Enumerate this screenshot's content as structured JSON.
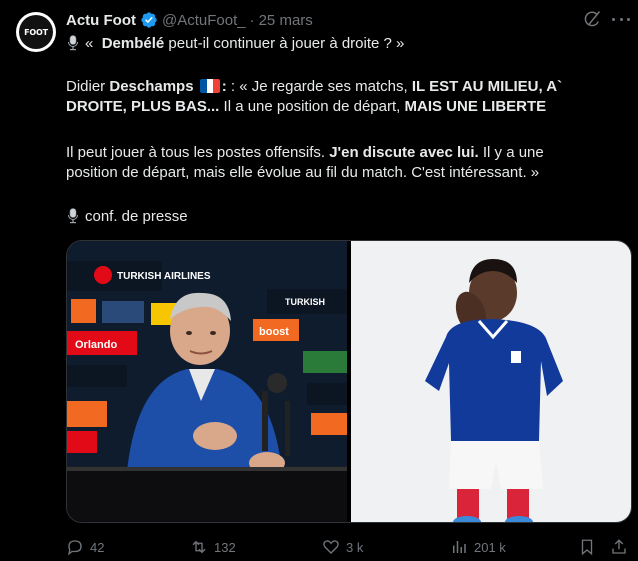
{
  "author": {
    "display_name": "Actu Foot",
    "handle": "@ActuFoot_",
    "separator": "·",
    "date": "25 mars",
    "avatar_text": "FOOT",
    "verified_color": "#1d9bf0"
  },
  "tweet": {
    "line1_prefix": "«",
    "line1_bold": "Dembélé",
    "line1_rest": " peut-il continuer à jouer à droite ? »",
    "line2_a": "Didier ",
    "line2_bold": "Deschamps",
    "line2_b": " : « Je regarde ses matchs, ",
    "line2_caps": "IL EST AU MILIEU, A`",
    "line3_caps": "DROITE, PLUS BAS...",
    "line3_mid": " Il a une position de départ, ",
    "line3_caps2": "MAIS UNE LIBERTE",
    "line4_a": "Il peut jouer à tous les postes offensifs. ",
    "line4_bold": "J'en discute avec lui.",
    "line4_b": " Il y a une",
    "line5": "position de départ, mais elle évolue au fil du match. C'est intéressant. »",
    "line6": "conf. de presse"
  },
  "media": {
    "photo1_alt": "press-conference-photo",
    "photo2_alt": "player-photo",
    "sign1": "TURKISH AIRLINES",
    "sign2": "boost",
    "sign3": "Orlando"
  },
  "actions": {
    "replies": "42",
    "reposts": "132",
    "likes": "3 k",
    "views": "201 k"
  },
  "colors": {
    "background": "#000000",
    "text": "#e7e9ea",
    "muted": "#71767b",
    "accent": "#1d9bf0"
  }
}
